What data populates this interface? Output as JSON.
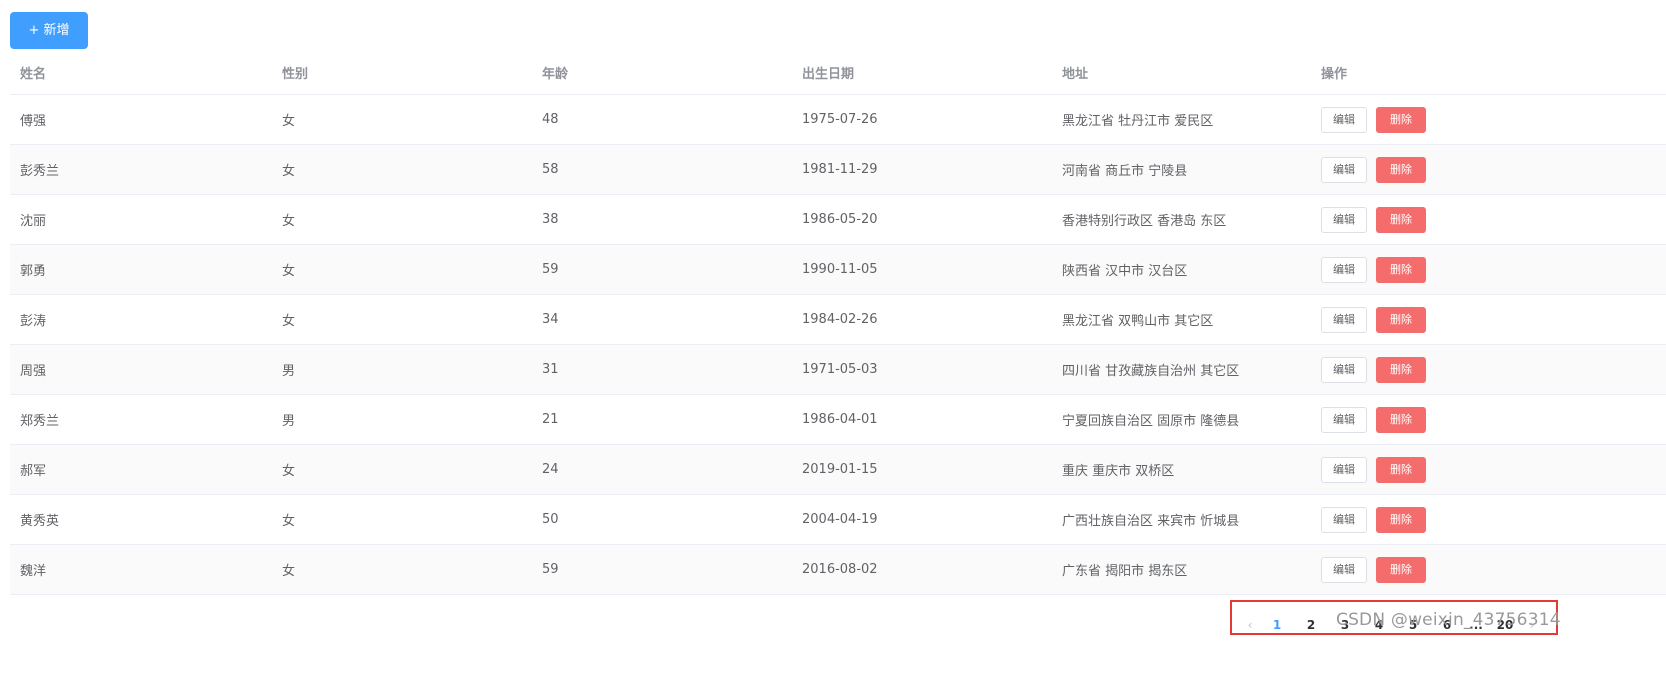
{
  "toolbar": {
    "add_label": "+ 新增"
  },
  "table": {
    "columns": [
      "姓名",
      "性别",
      "年龄",
      "出生日期",
      "地址",
      "操作"
    ],
    "rows": [
      {
        "name": "傅强",
        "gender": "女",
        "age": "48",
        "birth": "1975-07-26",
        "address": "黑龙江省 牡丹江市 爱民区"
      },
      {
        "name": "彭秀兰",
        "gender": "女",
        "age": "58",
        "birth": "1981-11-29",
        "address": "河南省 商丘市 宁陵县"
      },
      {
        "name": "沈丽",
        "gender": "女",
        "age": "38",
        "birth": "1986-05-20",
        "address": "香港特别行政区 香港岛 东区"
      },
      {
        "name": "郭勇",
        "gender": "女",
        "age": "59",
        "birth": "1990-11-05",
        "address": "陕西省 汉中市 汉台区"
      },
      {
        "name": "彭涛",
        "gender": "女",
        "age": "34",
        "birth": "1984-02-26",
        "address": "黑龙江省 双鸭山市 其它区"
      },
      {
        "name": "周强",
        "gender": "男",
        "age": "31",
        "birth": "1971-05-03",
        "address": "四川省 甘孜藏族自治州 其它区"
      },
      {
        "name": "郑秀兰",
        "gender": "男",
        "age": "21",
        "birth": "1986-04-01",
        "address": "宁夏回族自治区 固原市 隆德县"
      },
      {
        "name": "郝军",
        "gender": "女",
        "age": "24",
        "birth": "2019-01-15",
        "address": "重庆 重庆市 双桥区"
      },
      {
        "name": "黄秀英",
        "gender": "女",
        "age": "50",
        "birth": "2004-04-19",
        "address": "广西壮族自治区 来宾市 忻城县"
      },
      {
        "name": "魏洋",
        "gender": "女",
        "age": "59",
        "birth": "2016-08-02",
        "address": "广东省 揭阳市 揭东区"
      }
    ],
    "edit_label": "编辑",
    "delete_label": "删除"
  },
  "pagination": {
    "prev": "‹",
    "next": "›",
    "pages": [
      "1",
      "2",
      "3",
      "4",
      "5",
      "6"
    ],
    "ellipsis": "...",
    "last": "20",
    "current": "1"
  },
  "watermark": "CSDN @weixin_43756314",
  "colors": {
    "primary": "#409eff",
    "danger": "#f56c6c",
    "highlight_border": "#e53935"
  }
}
